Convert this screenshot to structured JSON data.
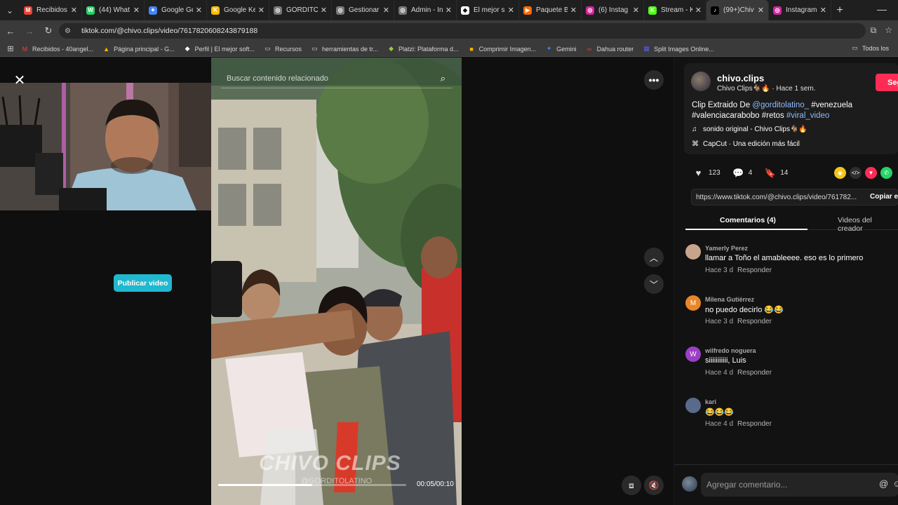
{
  "tabs": [
    {
      "title": "Recibidos",
      "favicon": "gmail-icon",
      "color": "#ea4335",
      "letter": "M"
    },
    {
      "title": "(44) What",
      "favicon": "whatsapp-icon",
      "color": "#25d366",
      "letter": "W"
    },
    {
      "title": "Google Ge",
      "favicon": "gemini-icon",
      "color": "#4285f4",
      "letter": "✦"
    },
    {
      "title": "Google Ke",
      "favicon": "keep-icon",
      "color": "#fbbc04",
      "letter": "K"
    },
    {
      "title": "GORDITO",
      "favicon": "globe-icon",
      "color": "#777777",
      "letter": "◎"
    },
    {
      "title": "Gestionar",
      "favicon": "globe-icon",
      "color": "#777777",
      "letter": "◎"
    },
    {
      "title": "Admin - In",
      "favicon": "globe-icon",
      "color": "#777777",
      "letter": "◎"
    },
    {
      "title": "El mejor s",
      "favicon": "diamond-icon",
      "color": "#ffffff",
      "letter": "◆"
    },
    {
      "title": "Paquete B",
      "favicon": "play-icon",
      "color": "#ff6a00",
      "letter": "▶"
    },
    {
      "title": "(6) Instag",
      "favicon": "instagram-icon",
      "color": "#d6249f",
      "letter": "◎"
    },
    {
      "title": "Stream - K",
      "favicon": "kick-icon",
      "color": "#53fc18",
      "letter": "K"
    },
    {
      "title": "(99+)Chiv",
      "favicon": "tiktok-icon",
      "color": "#000000",
      "letter": "♪",
      "active": true
    },
    {
      "title": "Instagram",
      "favicon": "instagram-icon",
      "color": "#d6249f",
      "letter": "◎"
    }
  ],
  "address": {
    "url": "tiktok.com/@chivo.clips/video/7617820608243879188"
  },
  "bookmarks": [
    {
      "label": "Recibidos - 40angel...",
      "icon": "gmail-icon",
      "color": "#ea4335",
      "glyph": "M"
    },
    {
      "label": "Página principal - G...",
      "icon": "drive-icon",
      "color": "#fbbc04",
      "glyph": "▲"
    },
    {
      "label": "Perfil | El mejor soft...",
      "icon": "diamond-icon",
      "color": "#ffffff",
      "glyph": "◆"
    },
    {
      "label": "Recursos",
      "icon": "folder-icon",
      "color": "#cfcfcf",
      "glyph": "▭"
    },
    {
      "label": "herramientas de tr...",
      "icon": "folder-icon",
      "color": "#cfcfcf",
      "glyph": "▭"
    },
    {
      "label": "Platzi: Plataforma d...",
      "icon": "platzi-icon",
      "color": "#98ca3f",
      "glyph": "◆"
    },
    {
      "label": "Comprimir Imagen...",
      "icon": "image-icon",
      "color": "#f4b400",
      "glyph": "■"
    },
    {
      "label": "Gemini",
      "icon": "gemini-icon",
      "color": "#4285f4",
      "glyph": "✦"
    },
    {
      "label": "Dahua router",
      "icon": "link-icon",
      "color": "#e04040",
      "glyph": "∞"
    },
    {
      "label": "Split Images Online...",
      "icon": "split-icon",
      "color": "#5a5af0",
      "glyph": "▦"
    }
  ],
  "bookmarks_other": "Todos los",
  "video": {
    "search_placeholder": "Buscar contenido relacionado",
    "watermark": "CHIVO CLIPS",
    "watermark_sub": "@GORDITOLATINO",
    "time": "00:05/00:10",
    "progress": 0.5
  },
  "publicar_label": "Publicar video",
  "author": {
    "name": "chivo.clips",
    "subtitle": "Chivo Clips🐐🔥 · Hace 1 sem.",
    "follow": "Seg",
    "desc_pre": "Clip Extraido De ",
    "desc_mention": "@gorditolatino_",
    "desc_mid1": " #venezuela #valenciacarabobo #retos ",
    "desc_tag": "#viral_video",
    "music": "sonido original - Chivo Clips🐐🔥",
    "capcut": "CapCut · Una edición más fácil"
  },
  "stats": {
    "likes": "123",
    "comments": "4",
    "saves": "14"
  },
  "link": {
    "url": "https://www.tiktok.com/@chivo.clips/video/761782...",
    "copy": "Copiar en"
  },
  "panel_tabs": {
    "comments": "Comentarios (4)",
    "creator": "Videos del creador"
  },
  "comments": [
    {
      "user": "Yamerly Perez",
      "text": "llamar a Toño el amableeee. eso es lo primero",
      "time": "Hace 3 d",
      "reply": "Responder",
      "avatar_color": "#c9a48c",
      "initial": ""
    },
    {
      "user": "Milena Gutiérrez",
      "text": "no puedo decirlo 😂😂",
      "time": "Hace 3 d",
      "reply": "Responder",
      "avatar_color": "#e8862a",
      "initial": "M"
    },
    {
      "user": "wilfredo noguera",
      "text": "siiiiiiiiiii, Luis",
      "time": "Hace 4 d",
      "reply": "Responder",
      "avatar_color": "#9b3fc4",
      "initial": "W"
    },
    {
      "user": "kari",
      "text": "😂😂😂",
      "time": "Hace 4 d",
      "reply": "Responder",
      "avatar_color": "#5a6a8a",
      "initial": ""
    }
  ],
  "composer": {
    "placeholder": "Agregar comentario..."
  }
}
